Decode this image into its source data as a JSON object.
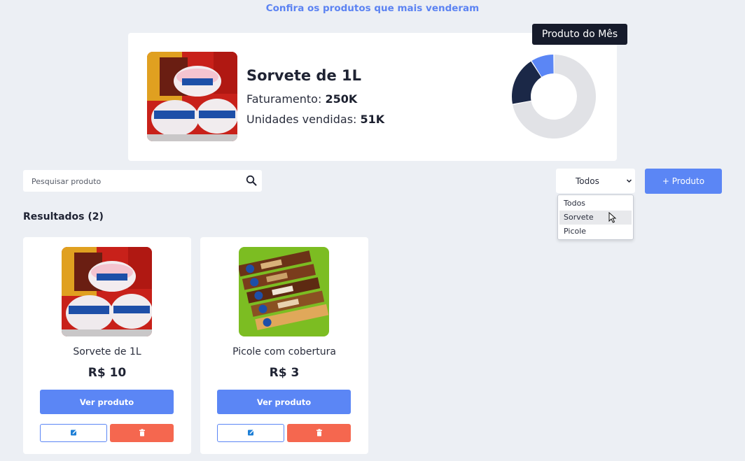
{
  "header": {
    "top_link": "Confira os produtos que mais venderam"
  },
  "tooltip": {
    "label": "Produto do Mês"
  },
  "featured": {
    "name": "Sorvete de 1L",
    "revenue_label": "Faturamento:",
    "revenue_value": "250K",
    "units_label": "Unidades vendidas:",
    "units_value": "51K",
    "donut": {
      "segments": [
        {
          "value": 0.72,
          "color": "#e1e2e6"
        },
        {
          "value": 0.19,
          "color": "#1b2847"
        },
        {
          "value": 0.09,
          "color": "#5b86f5"
        }
      ]
    }
  },
  "search": {
    "placeholder": "Pesquisar produto",
    "icon": "search-icon"
  },
  "filter": {
    "selected": "Todos",
    "options": [
      "Todos",
      "Sorvete",
      "Picole"
    ],
    "hovered_index": 1
  },
  "toolbar": {
    "add_label": "+ Produto"
  },
  "results": {
    "label": "Resultados (2)"
  },
  "products": [
    {
      "name": "Sorvete de 1L",
      "price": "R$ 10",
      "view_label": "Ver produto",
      "image": "ice-cream-tubs-image"
    },
    {
      "name": "Picole com cobertura",
      "price": "R$ 3",
      "view_label": "Ver produto",
      "image": "popsicle-packs-image"
    }
  ],
  "colors": {
    "accent": "#5b86f5",
    "danger": "#f5674f",
    "dark": "#161b2b",
    "link": "#5c83f2"
  }
}
